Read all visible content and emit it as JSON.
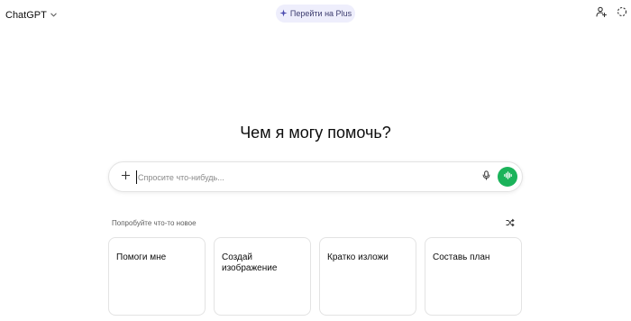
{
  "header": {
    "model_name": "ChatGPT",
    "upgrade_label": "Перейти на Plus",
    "upgrade_accent": "#4b4bb0",
    "icons": [
      "chevron-down-icon",
      "sparkle-icon",
      "add-person-icon",
      "temporary-chat-icon"
    ]
  },
  "main": {
    "heading": "Чем я могу помочь?"
  },
  "composer": {
    "placeholder": "Спросите что-нибудь...",
    "value": "",
    "voice_color": "#1bb35a"
  },
  "suggestions": {
    "title": "Попробуйте что-то новое",
    "cards": [
      {
        "label": "Помоги мне"
      },
      {
        "label": "Создай\nизображение"
      },
      {
        "label": "Кратко изложи"
      },
      {
        "label": "Составь план"
      }
    ]
  }
}
